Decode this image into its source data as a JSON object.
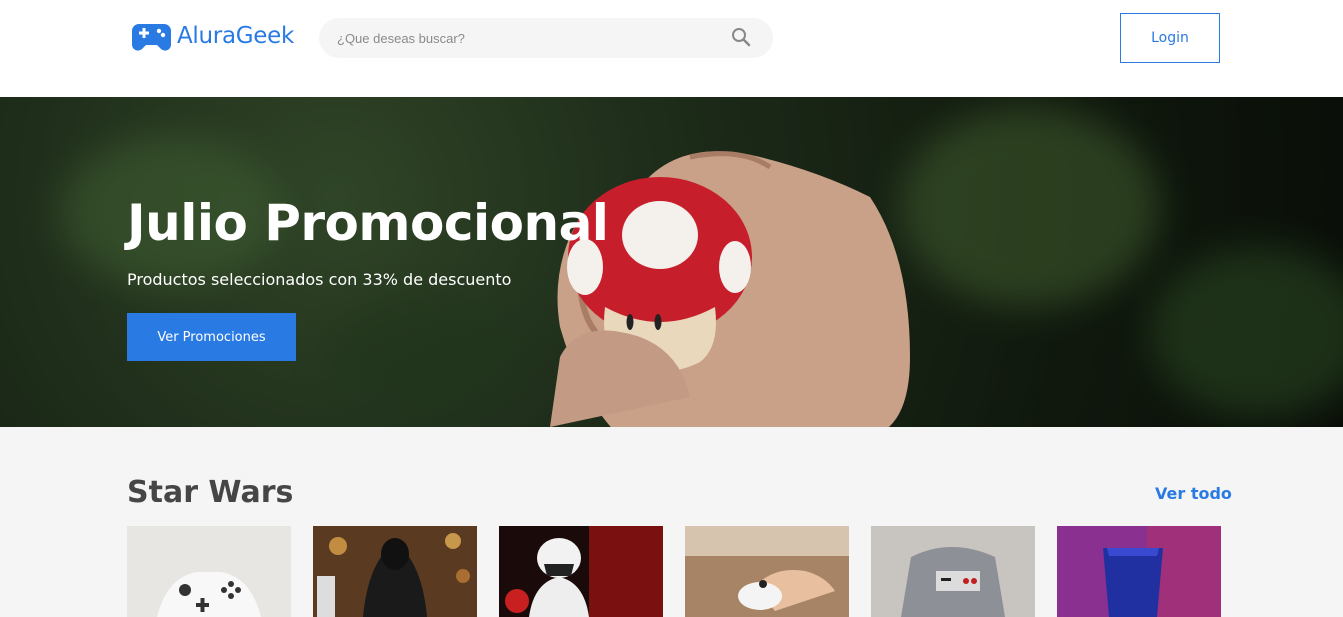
{
  "header": {
    "logo": {
      "part1": "Alura",
      "part2": "Geek",
      "icon": "gamepad-icon"
    },
    "search": {
      "placeholder": "¿Que deseas buscar?",
      "icon": "search-icon"
    },
    "login_label": "Login"
  },
  "hero": {
    "title": "Julio Promocional",
    "subtitle": "Productos seleccionados con 33% de descuento",
    "button_label": "Ver Promociones"
  },
  "section": {
    "title": "Star Wars",
    "see_all": "Ver todo",
    "products": [
      {
        "name": "xbox-controller"
      },
      {
        "name": "kylo-ren-figure"
      },
      {
        "name": "stormtrooper-figure"
      },
      {
        "name": "stormtrooper-mug"
      },
      {
        "name": "nes-shirt-child"
      },
      {
        "name": "console-box"
      }
    ]
  },
  "colors": {
    "accent": "#2a7ae4",
    "text_dark": "#464646",
    "background": "#f5f5f5"
  }
}
